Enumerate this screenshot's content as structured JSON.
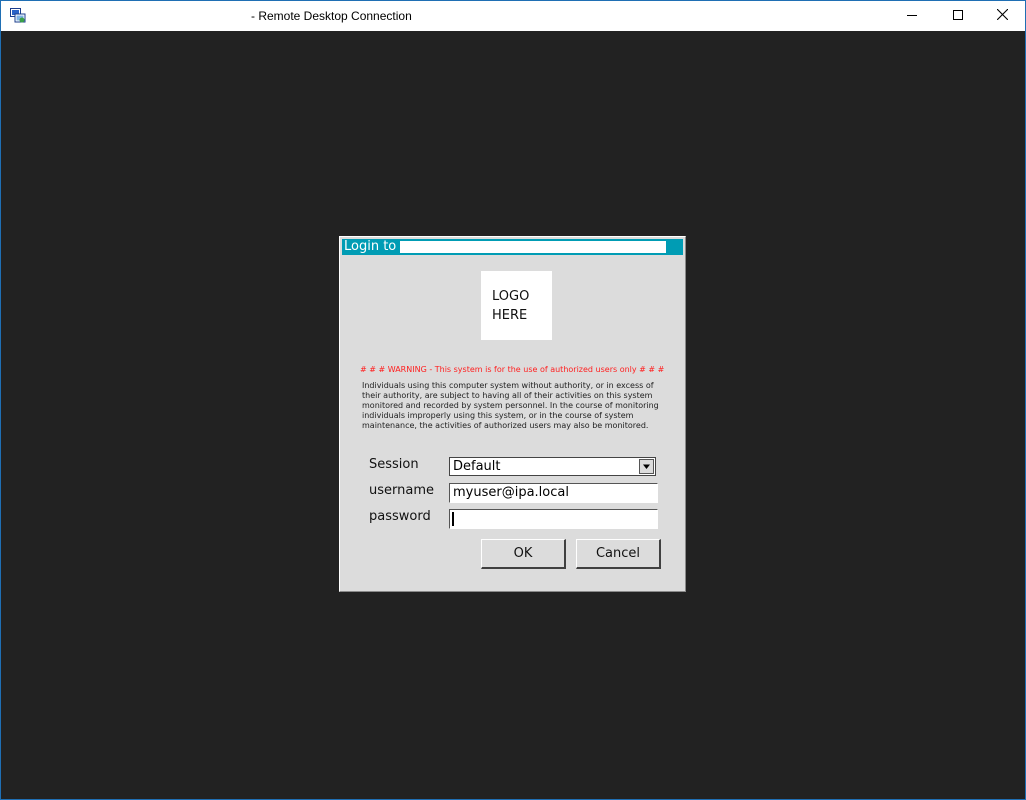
{
  "window": {
    "title": "- Remote Desktop Connection",
    "icon": "remote-desktop-icon",
    "controls": [
      "minimize-icon",
      "maximize-icon",
      "close-icon"
    ]
  },
  "dialog": {
    "title": "Login to",
    "title_bar_color": "#009cb4",
    "logo": {
      "line1": "LOGO",
      "line2": "HERE"
    },
    "warning_title": "# # #  WARNING - This system is for the use of authorized users only  # # #",
    "warning_title_color": "#ff2020",
    "warning_body": "Individuals using this computer system without authority, or in excess of their authority, are subject to having all of their activities on this system monitored and recorded by system personnel. In the course of monitoring individuals improperly using this system, or in the course of system maintenance, the activities of authorized users may also be monitored.",
    "fields": {
      "session_label": "Session",
      "session_value": "Default",
      "username_label": "username",
      "username_value": "myuser@ipa.local",
      "password_label": "password",
      "password_value": ""
    },
    "buttons": {
      "ok": "OK",
      "cancel": "Cancel"
    }
  }
}
